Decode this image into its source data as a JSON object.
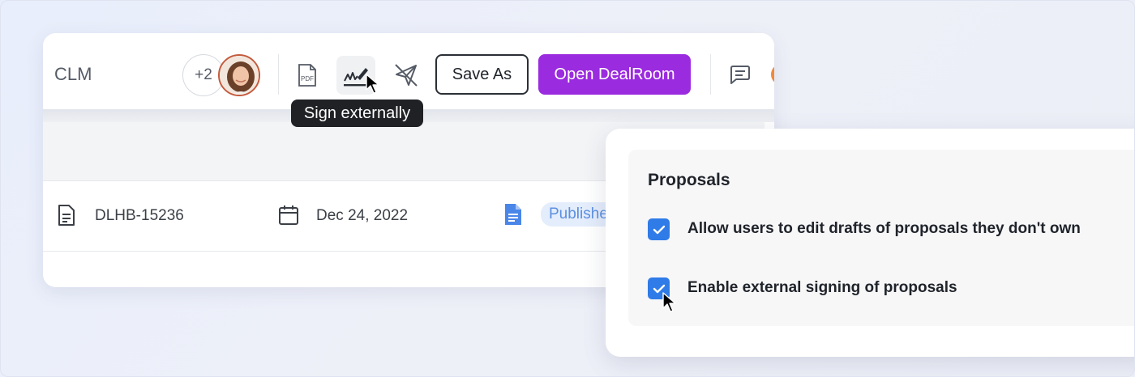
{
  "toolbar": {
    "app_title": "CLM",
    "avatar_extra_count": "+2",
    "pdf_label": "PDF",
    "save_as_label": "Save As",
    "open_dealroom_label": "Open DealRoom"
  },
  "tooltip": {
    "text": "Sign externally"
  },
  "document_row": {
    "id": "DLHB-15236",
    "date": "Dec 24, 2022",
    "status": "Publishe"
  },
  "proposals_panel": {
    "title": "Proposals",
    "options": [
      {
        "label": "Allow users to edit drafts of proposals they don't own",
        "checked": true
      },
      {
        "label": "Enable external signing of proposals",
        "checked": true
      }
    ]
  },
  "colors": {
    "accent_purple": "#9b2bdf",
    "checkbox_blue": "#2f7be8",
    "badge_bg": "#e4edfb",
    "badge_text": "#5b8fe0"
  },
  "icons": [
    "pdf-icon",
    "signature-icon",
    "send-off-icon",
    "comment-icon",
    "document-icon",
    "calendar-icon",
    "google-doc-icon",
    "check-icon",
    "mouse-cursor-icon"
  ]
}
